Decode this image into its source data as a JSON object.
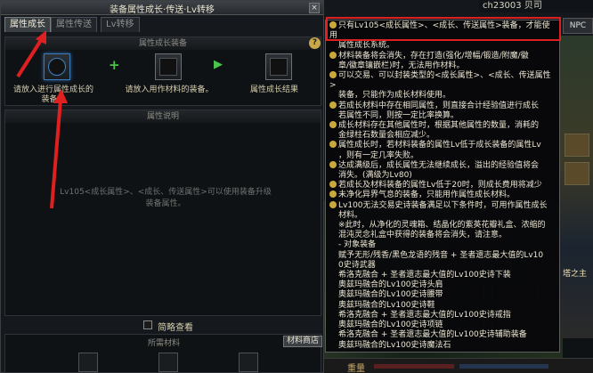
{
  "window": {
    "title": "装备属性成长·传送·Lv转移",
    "close": "×"
  },
  "tabs": [
    {
      "label": "属性成长",
      "active": true
    },
    {
      "label": "属性传送",
      "active": false
    },
    {
      "label": "Lv转移",
      "active": false
    }
  ],
  "growth": {
    "header": "属性成长装备",
    "help": "?",
    "slot1_label": "请放入进行属性成长的装备。",
    "slot2_label": "请放入用作材料的装备。",
    "slot3_label": "属性成长结果"
  },
  "attr": {
    "header": "属性说明",
    "desc": "Lv105<成长属性>、<成长、传送属性>可以使用装备升级装备属性。"
  },
  "quick_view": "简略查看",
  "materials": {
    "header": "所需材料",
    "shop_button": "材料商店"
  },
  "hud": {
    "name": "ch23003 贝司",
    "npc": "NPC",
    "side_text": "塔之主",
    "weight": "重量"
  },
  "tooltip": {
    "lines": [
      {
        "b": true,
        "t": "只有Lv105<成长属性>、<成长、传送属性>装备，才能使用"
      },
      {
        "b": false,
        "t": "属性成长系统。"
      },
      {
        "b": true,
        "t": "材料装备将会消失，存在打造(强化/增幅/锻造/附魔/徽"
      },
      {
        "b": false,
        "t": "章/徽章镶嵌栏)时，无法用作材料。"
      },
      {
        "b": true,
        "t": "可以交易、可以封装类型的<成长属性>、<成长、传送属性>"
      },
      {
        "b": false,
        "t": "装备，只能作为成长材料使用。"
      },
      {
        "b": true,
        "t": "若成长材料中存在相同属性，则直接合计经验值进行成长"
      },
      {
        "b": false,
        "t": "若属性不同，则按一定比率换算。"
      },
      {
        "b": true,
        "t": "成长材料存在其他属性时，根据其他属性的数量，消耗的"
      },
      {
        "b": false,
        "t": "金绿柱石数量会相应减少。"
      },
      {
        "b": true,
        "t": "属性成长时，若材料装备的属性Lv低于成长装备的属性Lv"
      },
      {
        "b": false,
        "t": "，则有一定几率失败。"
      },
      {
        "b": true,
        "t": "达成满级后，成长属性无法继续成长，溢出的经验值将会"
      },
      {
        "b": false,
        "t": "消失。(满级为Lv80)"
      },
      {
        "b": true,
        "t": "若成长及材料装备的属性Lv低于20时，则成长费用将减少"
      },
      {
        "b": true,
        "t": "未净化异界气息的装备，只能用作属性成长材料。"
      },
      {
        "b": true,
        "t": "Lv100无法交易史诗装备满足以下条件时，可用作属性成长"
      },
      {
        "b": false,
        "t": "材料。"
      },
      {
        "b": false,
        "t": "※此时，从净化的灵魂箱、结晶化的紫英花瓣礼盒、浓缩的"
      },
      {
        "b": false,
        "t": "混沌灵念礼盒中获得的装备将会消失，请注意。"
      },
      {
        "b": false,
        "t": "- 对象装备"
      },
      {
        "b": false,
        "t": "赋予无形/残香/黑色龙语的残音 + 圣者遗志最大值的Lv10"
      },
      {
        "b": false,
        "t": "0史诗武器"
      },
      {
        "b": false,
        "t": "希洛克融合 + 圣者遗志最大值的Lv100史诗下装"
      },
      {
        "b": false,
        "t": "奥兹玛融合的Lv100史诗头肩"
      },
      {
        "b": false,
        "t": "奥兹玛融合的Lv100史诗腰带"
      },
      {
        "b": false,
        "t": "奥兹玛融合的Lv100史诗鞋"
      },
      {
        "b": false,
        "t": "希洛克融合 + 圣者遗志最大值的Lv100史诗戒指"
      },
      {
        "b": false,
        "t": "奥兹玛融合的Lv100史诗项链"
      },
      {
        "b": false,
        "t": "希洛克融合 + 圣者遗志最大值的Lv100史诗辅助装备"
      },
      {
        "b": false,
        "t": "奥兹玛融合的Lv100史诗魔法石"
      }
    ]
  },
  "colors": {
    "annotation": "#e02020",
    "bullet": "#c9a83c",
    "plus": "#4cc54c",
    "text": "#ece6d3"
  }
}
